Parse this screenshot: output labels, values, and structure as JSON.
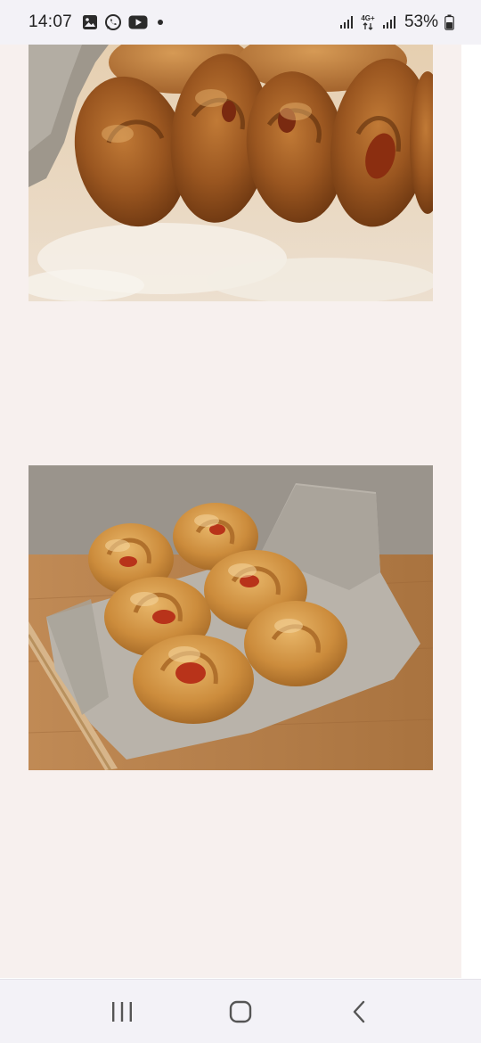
{
  "status_bar": {
    "time": "14:07",
    "notification_icons": [
      "gallery-icon",
      "whatsapp-icon",
      "youtube-icon",
      "dot-icon"
    ],
    "network_label": "4G+",
    "battery_percent": "53%",
    "battery_level": 0.53
  },
  "content": {
    "background_color": "#f7f0ee",
    "images": [
      {
        "name": "braided-bread-loaf-photo",
        "alt": ""
      },
      {
        "name": "bread-rolls-in-basket-photo",
        "alt": ""
      }
    ]
  },
  "nav_bar": {
    "buttons": [
      "recent-apps-icon",
      "home-icon",
      "back-icon"
    ]
  }
}
